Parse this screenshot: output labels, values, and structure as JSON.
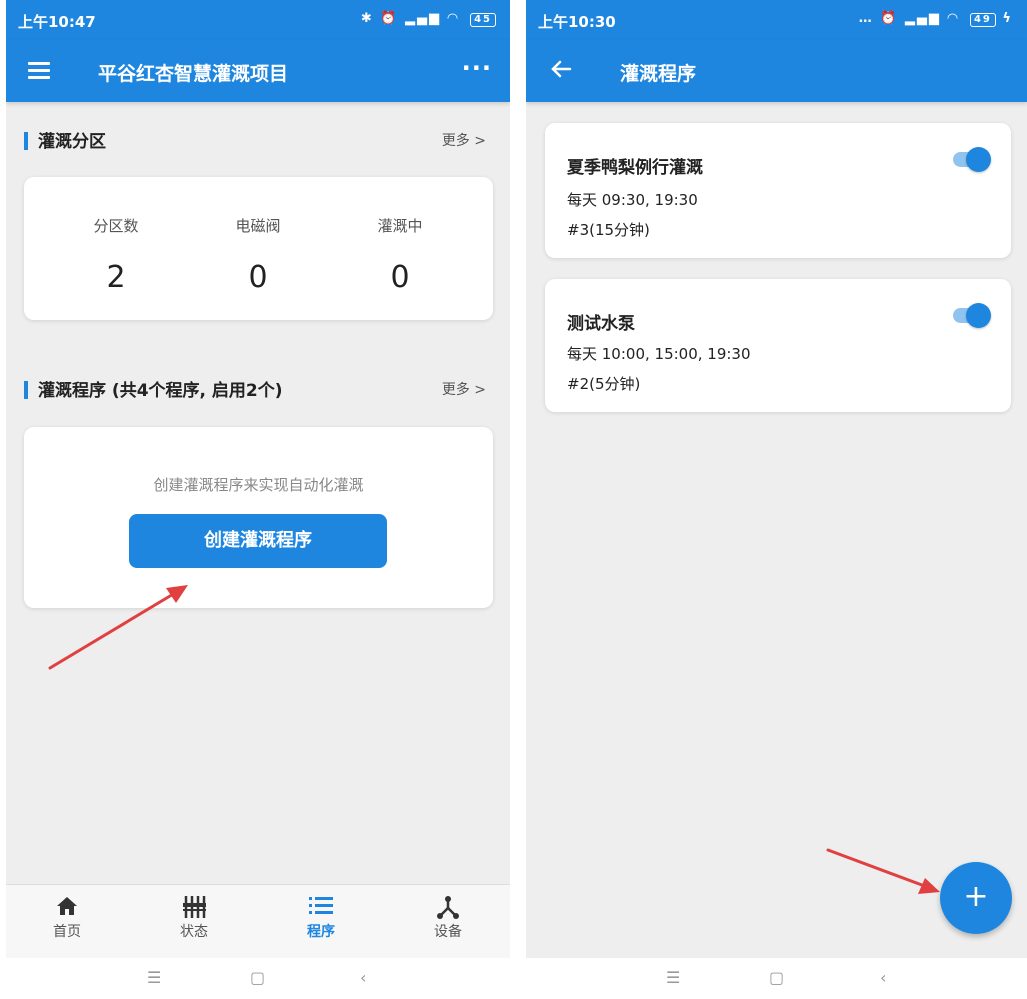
{
  "left": {
    "status_time": "上午10:47",
    "status_battery": "45",
    "title": "平谷红杏智慧灌溉项目",
    "zones": {
      "title": "灌溉分区",
      "more": "更多 >",
      "stats": [
        {
          "label": "分区数",
          "value": "2"
        },
        {
          "label": "电磁阀",
          "value": "0"
        },
        {
          "label": "灌溉中",
          "value": "0"
        }
      ]
    },
    "programs": {
      "title": "灌溉程序 (共4个程序, 启用2个)",
      "more": "更多 >",
      "hint": "创建灌溉程序来实现自动化灌溉",
      "create_button": "创建灌溉程序"
    },
    "nav": [
      {
        "label": "首页",
        "icon": "home-icon"
      },
      {
        "label": "状态",
        "icon": "sliders-icon"
      },
      {
        "label": "程序",
        "icon": "list-icon",
        "active": true
      },
      {
        "label": "设备",
        "icon": "network-icon"
      }
    ]
  },
  "right": {
    "status_time": "上午10:30",
    "status_battery": "49",
    "title": "灌溉程序",
    "programs": [
      {
        "name": "夏季鸭梨例行灌溉",
        "schedule": "每天  09:30, 19:30",
        "detail": "#3(15分钟)",
        "enabled": true
      },
      {
        "name": "测试水泵",
        "schedule": "每天  10:00, 15:00, 19:30",
        "detail": "#2(5分钟)",
        "enabled": true
      }
    ],
    "fab_label": "+"
  },
  "colors": {
    "primary": "#1e86df",
    "arrow": "#e04040",
    "background": "#eeeeee"
  }
}
